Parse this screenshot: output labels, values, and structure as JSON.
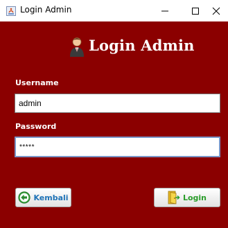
{
  "window": {
    "title": "Login Admin",
    "controls": {
      "minimize": "minimize",
      "maximize": "maximize",
      "close": "close"
    }
  },
  "header": {
    "title": "Login Admin",
    "icon": "admin-user-icon"
  },
  "form": {
    "username": {
      "label": "Username",
      "value": "admin"
    },
    "password": {
      "label": "Password",
      "value": "*****"
    }
  },
  "buttons": {
    "back": {
      "label": "Kembali",
      "icon": "back-arrow-icon"
    },
    "login": {
      "label": "Login",
      "icon": "door-icon"
    }
  },
  "colors": {
    "panel_background": "#8b0000",
    "text_light": "#ffffff",
    "back_label": "#1f73b7",
    "login_label": "#2a9d2a"
  }
}
